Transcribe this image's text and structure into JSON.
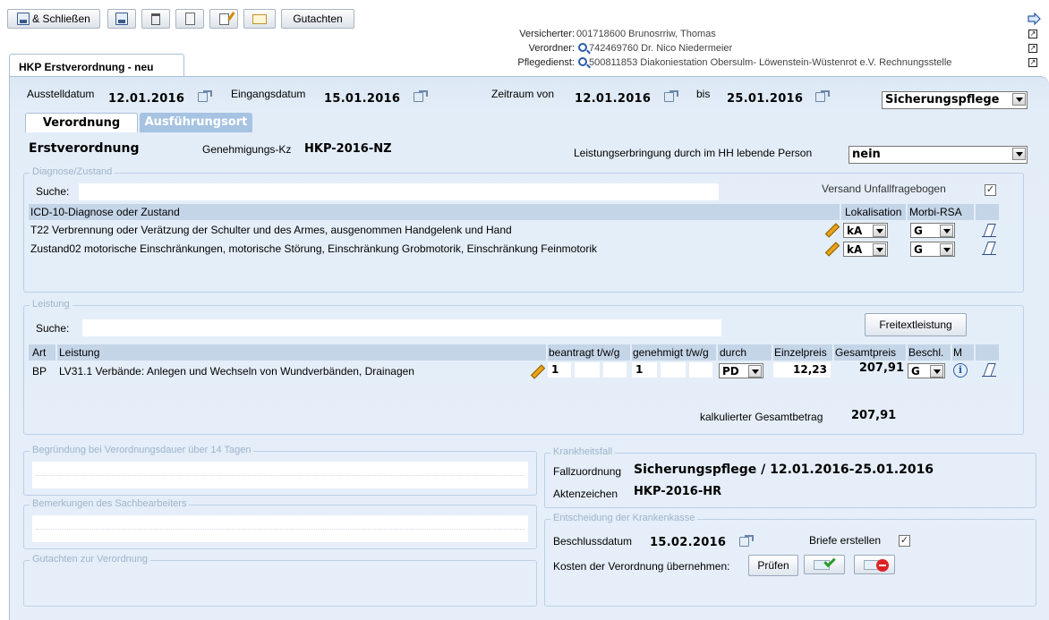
{
  "toolbar": {
    "save_close_label": "& Schließen",
    "gutachten_label": "Gutachten"
  },
  "header": {
    "versicherter_label": "Versicherter:",
    "versicherter_value": "001718600 Brunosrriw, Thomas",
    "verordner_label": "Verordner:",
    "verordner_value": "742469760 Dr. Nico Niedermeier",
    "pflegedienst_label": "Pflegedienst:",
    "pflegedienst_value": "500811853 Diakoniestation Obersulm- Löwenstein-Wüstenrot e.V. Rechnungsstelle"
  },
  "main_tab": {
    "label": "HKP Erstverordnung - neu"
  },
  "dates": {
    "ausstelldatum_label": "Ausstelldatum",
    "ausstelldatum_value": "12.01.2016",
    "eingangsdatum_label": "Eingangsdatum",
    "eingangsdatum_value": "15.01.2016",
    "zeitraum_von_label": "Zeitraum von",
    "zeitraum_von_value": "12.01.2016",
    "bis_label": "bis",
    "bis_value": "25.01.2016",
    "pflegeart_value": "Sicherungspflege"
  },
  "tabs": {
    "verordnung": "Verordnung",
    "ausfuehrungsort": "Ausführungsort"
  },
  "verordnung": {
    "type": "Erstverordnung",
    "genehmigungs_label": "Genehmigungs-Kz",
    "genehmigungs_value": "HKP-2016-NZ",
    "leistungserbringung_label": "Leistungserbringung durch im HH lebende Person",
    "leistungserbringung_value": "nein"
  },
  "diagnose": {
    "legend": "Diagnose/Zustand",
    "search_label": "Suche:",
    "versand_label": "Versand Unfallfragebogen",
    "versand_checked": "✓",
    "col_diagnose": "ICD-10-Diagnose oder Zustand",
    "col_lokalisation": "Lokalisation",
    "col_morbi": "Morbi-RSA",
    "rows": [
      {
        "text": "T22 Verbrennung oder Verätzung der Schulter und des Armes, ausgenommen Handgelenk und Hand",
        "lokalisation": "kA",
        "morbi": "G"
      },
      {
        "text": "Zustand02 motorische Einschränkungen, motorische Störung, Einschränkung Grobmotorik, Einschränkung Feinmotorik",
        "lokalisation": "kA",
        "morbi": "G"
      }
    ]
  },
  "leistung": {
    "legend": "Leistung",
    "search_label": "Suche:",
    "freitext_button": "Freitextleistung",
    "col_art": "Art",
    "col_leistung": "Leistung",
    "col_beantragt": "beantragt t/w/g",
    "col_genehmigt": "genehmigt t/w/g",
    "col_durch": "durch",
    "col_einzelpreis": "Einzelpreis",
    "col_gesamtpreis": "Gesamtpreis",
    "col_beschl": "Beschl.",
    "col_m": "M",
    "rows": [
      {
        "art": "BP",
        "leistung": "LV31.1 Verbände: Anlegen und Wechseln von Wundverbänden, Drainagen",
        "beantragt_t": "1",
        "genehmigt_t": "1",
        "durch": "PD",
        "einzelpreis": "12,23",
        "gesamtpreis": "207,91",
        "beschl": "G"
      }
    ],
    "total_label": "kalkulierter Gesamtbetrag",
    "total_value": "207,91"
  },
  "begruendung": {
    "legend": "Begründung bei Verordnungsdauer über 14 Tagen"
  },
  "bemerkungen": {
    "legend": "Bemerkungen des Sachbearbeiters"
  },
  "gutachten": {
    "legend": "Gutachten zur Verordnung"
  },
  "krankheitsfall": {
    "legend": "Krankheitsfall",
    "fallzuordnung_label": "Fallzuordnung",
    "fallzuordnung_value": "Sicherungspflege / 12.01.2016-25.01.2016",
    "aktenzeichen_label": "Aktenzeichen",
    "aktenzeichen_value": "HKP-2016-HR"
  },
  "entscheidung": {
    "legend": "Entscheidung der Krankenkasse",
    "beschlussdatum_label": "Beschlussdatum",
    "beschlussdatum_value": "15.02.2016",
    "briefe_label": "Briefe erstellen",
    "briefe_checked": "✓",
    "kosten_label": "Kosten der Verordnung übernehmen:",
    "pruefen_button": "Prüfen"
  }
}
